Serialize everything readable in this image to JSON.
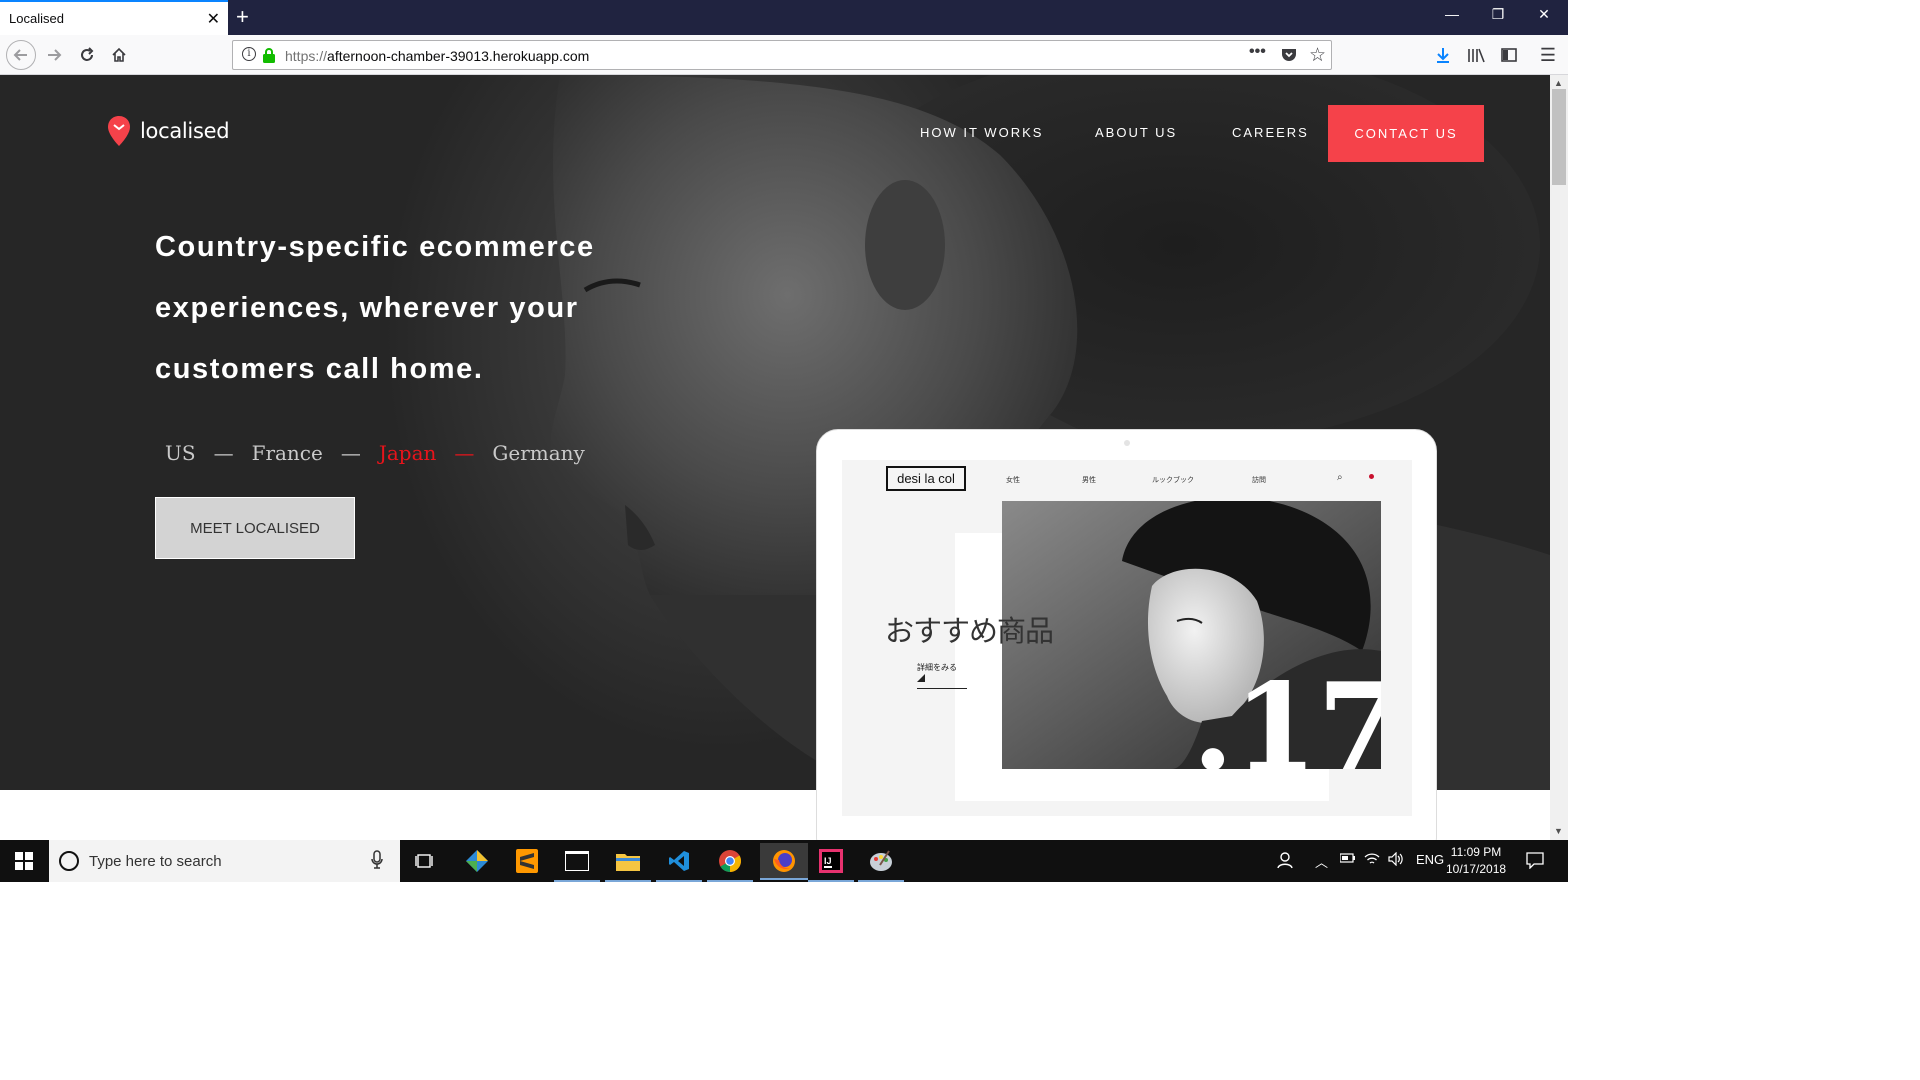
{
  "browser": {
    "tab_title": "Localised",
    "url_protocol": "https://",
    "url_host": "afternoon-chamber-39013.herokuapp.com",
    "accent": "#0a84ff"
  },
  "site": {
    "logo_text": "localised",
    "nav": {
      "how_it_works": "HOW IT WORKS",
      "about_us": "ABOUT US",
      "careers": "CAREERS",
      "contact_us": "CONTACT US"
    },
    "headline": "Country-specific ecommerce experiences, wherever your customers call home.",
    "countries": [
      "US",
      "France",
      "Japan",
      "Germany"
    ],
    "active_country": "Japan",
    "meet_button": "MEET LOCALISED",
    "brand_color": "#f5424a",
    "mockup": {
      "logo": "desi la col",
      "nav": [
        "女性",
        "男性",
        "ルックブック",
        "訪問"
      ],
      "heading": "おすすめ商品",
      "link": "詳細をみる",
      "photo_number": ".17"
    }
  },
  "taskbar": {
    "search_placeholder": "Type here to search",
    "language": "ENG",
    "time": "11:09 PM",
    "date": "10/17/2018"
  }
}
